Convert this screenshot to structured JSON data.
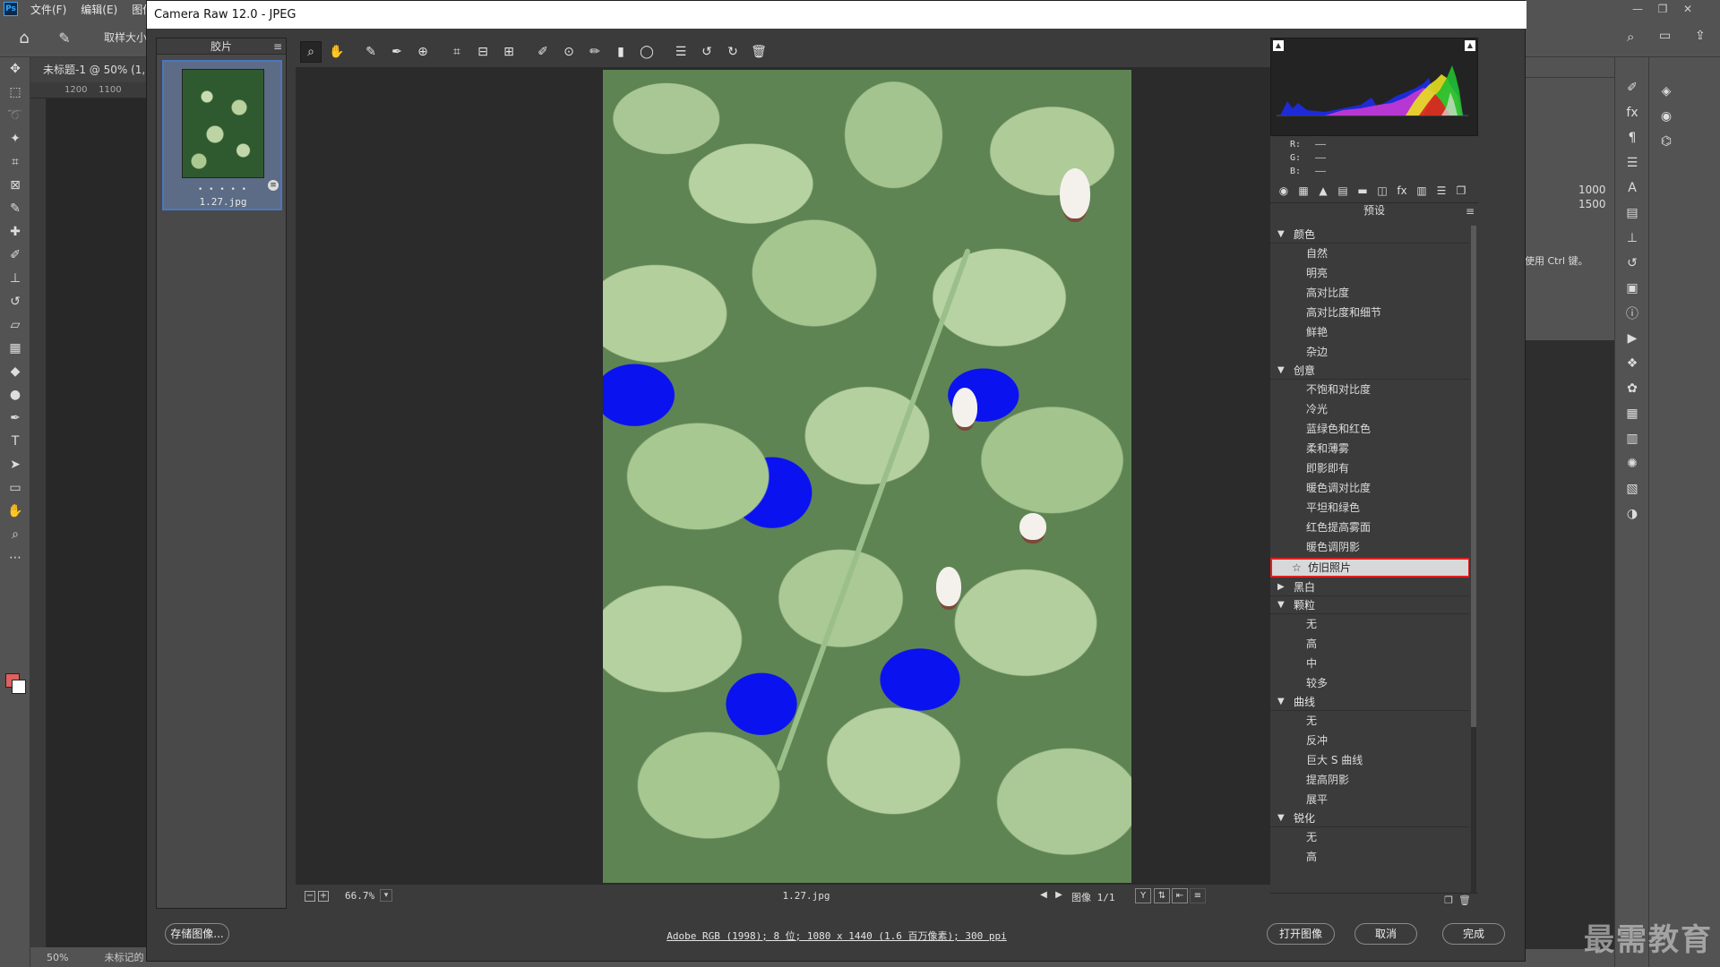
{
  "ps": {
    "logo": "Ps",
    "menu": [
      "文件(F)",
      "编辑(E)",
      "图像("
    ],
    "options_label": "取样大小",
    "doc_tab": "未标题-1 @ 50% (1,",
    "ruler_h": "1200    1100",
    "status_zoom": "50%",
    "status_doc": "未标记的",
    "panel_values": [
      "1000",
      "1500"
    ],
    "panel_hint": "使用 Ctrl 键。",
    "watermark": "最需教育"
  },
  "camera_raw": {
    "title": "Camera Raw 12.0 -  JPEG",
    "filmstrip": {
      "header": "胶片",
      "thumbnail": {
        "stars": "• • • • •",
        "name": "1.27.jpg"
      }
    },
    "toolbar_icons": [
      "zoom-icon",
      "hand-icon",
      "white-balance-icon",
      "color-sampler-icon",
      "targeted-adjustment-icon",
      "crop-icon",
      "straighten-icon",
      "transform-icon",
      "spot-removal-icon",
      "red-eye-icon",
      "adjustment-brush-icon",
      "graduated-filter-icon",
      "radial-filter-icon",
      "preferences-icon",
      "rotate-ccw-icon",
      "rotate-cw-icon",
      "delete-icon"
    ],
    "bottom": {
      "zoom": "66.7%",
      "filename": "1.27.jpg",
      "image_count": "图像 1/1"
    },
    "histogram": {
      "r_label": "R:",
      "g_label": "G:",
      "b_label": "B:",
      "r_value": "——",
      "g_value": "——",
      "b_value": "——"
    },
    "panel_title": "预设",
    "preset_groups": [
      {
        "name": "颜色",
        "expanded": true,
        "items": [
          "自然",
          "明亮",
          "高对比度",
          "高对比度和细节",
          "鲜艳",
          "杂边"
        ]
      },
      {
        "name": "创意",
        "expanded": true,
        "items": [
          "不饱和对比度",
          "冷光",
          "蓝绿色和红色",
          "柔和薄雾",
          "即影即有",
          "暖色调对比度",
          "平坦和绿色",
          "红色提高雾面",
          "暖色调阴影",
          "仿旧照片"
        ],
        "selected": "仿旧照片"
      },
      {
        "name": "黑白",
        "expanded": false,
        "items": []
      },
      {
        "name": "颗粒",
        "expanded": true,
        "items": [
          "无",
          "高",
          "中",
          "较多"
        ]
      },
      {
        "name": "曲线",
        "expanded": true,
        "items": [
          "无",
          "反冲",
          "巨大 S 曲线",
          "提高阴影",
          "展平"
        ]
      },
      {
        "name": "锐化",
        "expanded": true,
        "items": [
          "无",
          "高"
        ]
      }
    ],
    "footer": {
      "save_label": "存储图像...",
      "info": "Adobe RGB (1998); 8 位; 1080 x 1440 (1.6 百万像素); 300 ppi",
      "open_label": "打开图像",
      "cancel_label": "取消",
      "done_label": "完成"
    }
  }
}
